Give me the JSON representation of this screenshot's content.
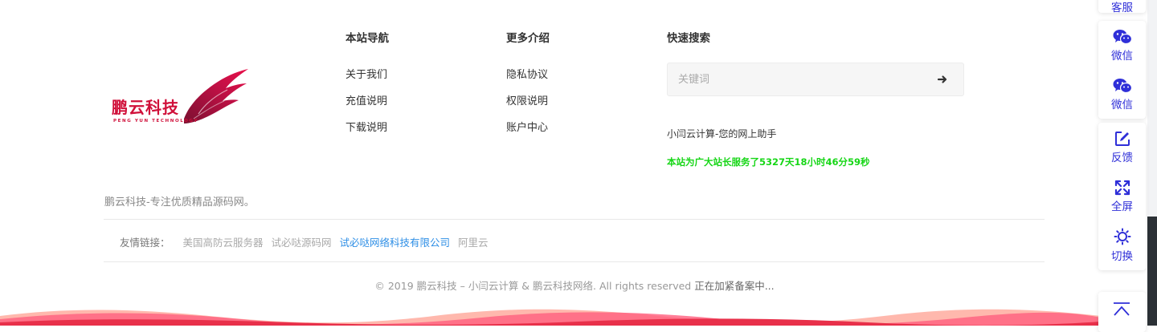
{
  "brand": {
    "logo_cn": "鹏云科技",
    "logo_en": "PENG YUN TECHNOLOGY",
    "brand_color": "#d0103a"
  },
  "nav": {
    "title": "本站导航",
    "links": [
      "关于我们",
      "充值说明",
      "下载说明"
    ]
  },
  "more": {
    "title": "更多介绍",
    "links": [
      "隐私协议",
      "权限说明",
      "账户中心"
    ]
  },
  "search": {
    "title": "快速搜索",
    "placeholder": "关键词",
    "button_icon": "arrow-right-icon"
  },
  "tagline": "小闫云计算-您的网上助手",
  "uptime": "本站为广大站长服务了5327天18小时46分59秒",
  "site_desc": "鹏云科技-专注优质精品源码网。",
  "friend_links": {
    "label": "友情链接：",
    "links": [
      {
        "text": "美国高防云服务器",
        "active": false
      },
      {
        "text": "试必哒源码网",
        "active": false
      },
      {
        "text": "试必哒网络科技有限公司",
        "active": true
      },
      {
        "text": "阿里云",
        "active": false
      }
    ]
  },
  "footer": {
    "copyright": "© 2019 鹏云科技 – 小闫云计算 & 鹏云科技网络. All rights reserved",
    "icp": "正在加紧备案中..."
  },
  "side_panel": {
    "top_label": "客服",
    "items": [
      {
        "label": "微信",
        "icon": "wechat-icon"
      },
      {
        "label": "微信",
        "icon": "wechat-icon"
      },
      {
        "label": "反馈",
        "icon": "edit-icon"
      },
      {
        "label": "全屏",
        "icon": "fullscreen-icon"
      },
      {
        "label": "切换",
        "icon": "sun-icon"
      }
    ],
    "back_to_top_icon": "chevron-up-icon",
    "accent": "#2f2fd8"
  },
  "colors": {
    "uptime_green": "#16d616",
    "link_blue": "#2f8fe6"
  }
}
